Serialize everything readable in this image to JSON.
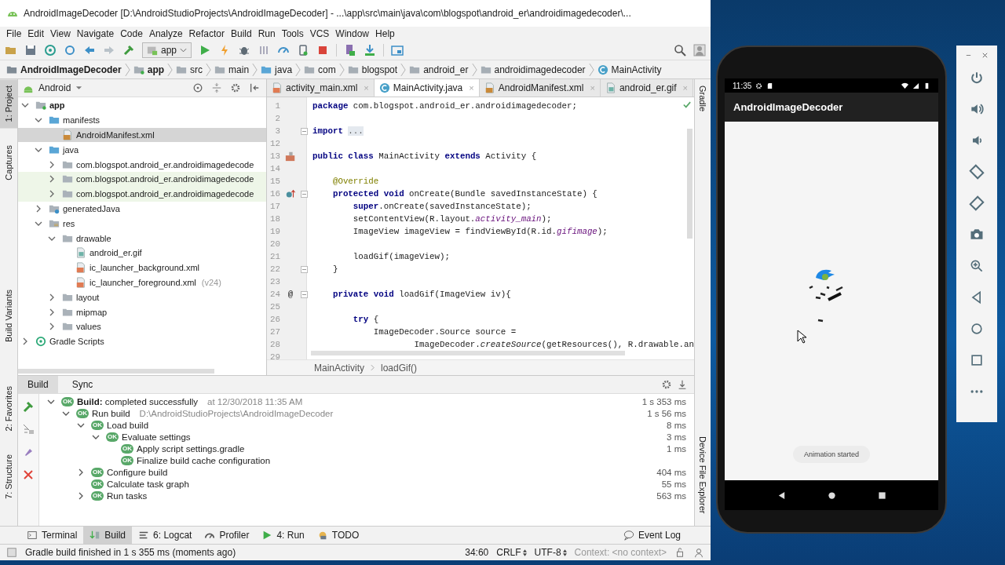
{
  "window": {
    "title": "AndroidImageDecoder [D:\\AndroidStudioProjects\\AndroidImageDecoder] - ...\\app\\src\\main\\java\\com\\blogspot\\android_er\\androidimagedecoder\\..."
  },
  "menu": [
    "File",
    "Edit",
    "View",
    "Navigate",
    "Code",
    "Analyze",
    "Refactor",
    "Build",
    "Run",
    "Tools",
    "VCS",
    "Window",
    "Help"
  ],
  "toolbar": {
    "run_config": "app"
  },
  "nav_bar": [
    {
      "label": "AndroidImageDecoder",
      "kind": "project"
    },
    {
      "label": "app",
      "kind": "module"
    },
    {
      "label": "src",
      "kind": "folder"
    },
    {
      "label": "main",
      "kind": "folder"
    },
    {
      "label": "java",
      "kind": "source"
    },
    {
      "label": "com",
      "kind": "folder"
    },
    {
      "label": "blogspot",
      "kind": "folder"
    },
    {
      "label": "android_er",
      "kind": "folder"
    },
    {
      "label": "androidimagedecoder",
      "kind": "folder"
    },
    {
      "label": "MainActivity",
      "kind": "class"
    }
  ],
  "left_strip_top": [
    {
      "label": "1: Project",
      "selected": true
    },
    {
      "label": "Captures",
      "selected": false
    }
  ],
  "left_strip_bottom": [
    {
      "label": "Build Variants",
      "selected": false
    },
    {
      "label": "2: Favorites",
      "selected": false
    },
    {
      "label": "7: Structure",
      "selected": false
    }
  ],
  "project": {
    "view": "Android",
    "tree": [
      {
        "label": "app",
        "kind": "module",
        "expanded": true,
        "selected": false,
        "test": false,
        "children": [
          {
            "label": "manifests",
            "kind": "source",
            "expanded": true,
            "selected": false,
            "test": false,
            "children": [
              {
                "label": "AndroidManifest.xml",
                "kind": "manifest",
                "selected": true,
                "test": false
              }
            ]
          },
          {
            "label": "java",
            "kind": "source",
            "expanded": true,
            "selected": false,
            "test": false,
            "children": [
              {
                "label": "com.blogspot.android_er.androidimagedecode",
                "kind": "package",
                "expanded": false,
                "selected": false,
                "test": false
              },
              {
                "label": "com.blogspot.android_er.androidimagedecode",
                "kind": "package",
                "expanded": false,
                "selected": false,
                "test": true
              },
              {
                "label": "com.blogspot.android_er.androidimagedecode",
                "kind": "package",
                "expanded": false,
                "selected": false,
                "test": true
              }
            ]
          },
          {
            "label": "generatedJava",
            "kind": "generated",
            "expanded": false,
            "selected": false,
            "test": false
          },
          {
            "label": "res",
            "kind": "res",
            "expanded": true,
            "selected": false,
            "test": false,
            "children": [
              {
                "label": "drawable",
                "kind": "package",
                "expanded": true,
                "selected": false,
                "test": false,
                "children": [
                  {
                    "label": "android_er.gif",
                    "kind": "gif",
                    "selected": false,
                    "test": false
                  },
                  {
                    "label": "ic_launcher_background.xml",
                    "kind": "xml",
                    "selected": false,
                    "test": false
                  },
                  {
                    "label": "ic_launcher_foreground.xml",
                    "hint": "(v24)",
                    "kind": "xml",
                    "selected": false,
                    "test": false
                  }
                ]
              },
              {
                "label": "layout",
                "kind": "package",
                "expanded": false,
                "selected": false,
                "test": false
              },
              {
                "label": "mipmap",
                "kind": "package",
                "expanded": false,
                "selected": false,
                "test": false
              },
              {
                "label": "values",
                "kind": "package",
                "expanded": false,
                "selected": false,
                "test": false
              }
            ]
          }
        ]
      },
      {
        "label": "Gradle Scripts",
        "kind": "gradle",
        "expanded": false,
        "selected": false,
        "test": false
      }
    ]
  },
  "editor": {
    "tabs": [
      {
        "label": "activity_main.xml",
        "kind": "xml",
        "close": "×",
        "selected": false
      },
      {
        "label": "MainActivity.java",
        "kind": "class",
        "close": "×",
        "selected": true
      },
      {
        "label": "AndroidManifest.xml",
        "kind": "manifest",
        "close": "×",
        "selected": false
      },
      {
        "label": "android_er.gif",
        "kind": "gif",
        "close": "×",
        "selected": false
      }
    ],
    "lines": [
      {
        "number": "1",
        "tokens": [
          {
            "text": "package",
            "kind": "keyword"
          },
          {
            "text": " com.blogspot.android_er.androidimagedecoder;",
            "kind": "plain"
          }
        ]
      },
      {
        "number": "2"
      },
      {
        "number": "3",
        "fold": true,
        "tokens": [
          {
            "text": "import ",
            "kind": "keyword"
          },
          {
            "text": "...",
            "kind": "folded"
          }
        ]
      },
      {
        "number": "12"
      },
      {
        "number": "13",
        "kind": "layout",
        "tokens": [
          {
            "text": "public class",
            "kind": "keyword"
          },
          {
            "text": " MainActivity ",
            "kind": "plain"
          },
          {
            "text": "extends",
            "kind": "keyword"
          },
          {
            "text": " Activity {",
            "kind": "plain"
          }
        ]
      },
      {
        "number": "14"
      },
      {
        "number": "15",
        "tokens": [
          {
            "text": "    @Override",
            "kind": "annotation"
          }
        ]
      },
      {
        "number": "16",
        "kind": "override",
        "fold": true,
        "tokens": [
          {
            "text": "    protected void",
            "kind": "keyword"
          },
          {
            "text": " onCreate(Bundle savedInstanceState) {",
            "kind": "plain"
          }
        ]
      },
      {
        "number": "17",
        "tokens": [
          {
            "text": "        super",
            "kind": "keyword"
          },
          {
            "text": ".onCreate(savedInstanceState);",
            "kind": "plain"
          }
        ]
      },
      {
        "number": "18",
        "tokens": [
          {
            "text": "        setContentView(R.layout.",
            "kind": "plain"
          },
          {
            "text": "activity_main",
            "kind": "field"
          },
          {
            "text": ");",
            "kind": "plain"
          }
        ]
      },
      {
        "number": "19",
        "tokens": [
          {
            "text": "        ImageView imageView = findViewById(R.id.",
            "kind": "plain"
          },
          {
            "text": "gifimage",
            "kind": "field"
          },
          {
            "text": ");",
            "kind": "plain"
          }
        ]
      },
      {
        "number": "20"
      },
      {
        "number": "21",
        "tokens": [
          {
            "text": "        loadGif(imageView);",
            "kind": "plain"
          }
        ]
      },
      {
        "number": "22",
        "fold": true,
        "tokens": [
          {
            "text": "    }",
            "kind": "plain"
          }
        ]
      },
      {
        "number": "23"
      },
      {
        "number": "24",
        "gutter_text": "@",
        "fold": true,
        "tokens": [
          {
            "text": "    private void",
            "kind": "keyword"
          },
          {
            "text": " loadGif(ImageView iv){",
            "kind": "plain"
          }
        ]
      },
      {
        "number": "25"
      },
      {
        "number": "26",
        "tokens": [
          {
            "text": "        try",
            "kind": "keyword"
          },
          {
            "text": " {",
            "kind": "plain"
          }
        ]
      },
      {
        "number": "27",
        "tokens": [
          {
            "text": "            ImageDecoder.Source source =",
            "kind": "plain"
          }
        ]
      },
      {
        "number": "28",
        "tokens": [
          {
            "text": "                    ImageDecoder.",
            "kind": "plain"
          },
          {
            "text": "createSource",
            "kind": "static"
          },
          {
            "text": "(getResources(), R.drawable.an",
            "kind": "plain"
          }
        ]
      },
      {
        "number": "29"
      }
    ],
    "breadcrumb": [
      "MainActivity",
      "loadGif()"
    ]
  },
  "right_strip_top": [
    {
      "label": "Gradle"
    }
  ],
  "right_strip_bottom": [
    {
      "label": "Device File Explorer"
    }
  ],
  "build": {
    "tabs": [
      {
        "label": "Build",
        "selected": true
      },
      {
        "label": "Sync",
        "selected": false
      }
    ],
    "tree": [
      {
        "label": "**Build:** completed successfully",
        "badge": "OK",
        "detail": "at 12/30/2018 11:35 AM",
        "time": "1 s 353 ms",
        "expanded": true,
        "children": [
          {
            "label": "Run build",
            "badge": "OK",
            "detail": "D:\\AndroidStudioProjects\\AndroidImageDecoder",
            "time": "1 s 56 ms",
            "expanded": true,
            "children": [
              {
                "label": "Load build",
                "badge": "OK",
                "time": "8 ms",
                "expanded": true,
                "children": [
                  {
                    "label": "Evaluate settings",
                    "badge": "OK",
                    "time": "3 ms",
                    "expanded": true,
                    "children": [
                      {
                        "label": "Apply script settings.gradle",
                        "badge": "OK",
                        "time": "1 ms"
                      },
                      {
                        "label": "Finalize build cache configuration",
                        "badge": "OK"
                      }
                    ]
                  }
                ]
              },
              {
                "label": "Configure build",
                "badge": "OK",
                "time": "404 ms",
                "expanded": false
              },
              {
                "label": "Calculate task graph",
                "badge": "OK",
                "time": "55 ms"
              },
              {
                "label": "Run tasks",
                "badge": "OK",
                "time": "563 ms",
                "expanded": false
              }
            ]
          }
        ]
      }
    ]
  },
  "tool_tabs": [
    {
      "label": "Terminal",
      "kind": "terminal",
      "selected": false
    },
    {
      "label": "Build",
      "kind": "build",
      "selected": true
    },
    {
      "label": "6: Logcat",
      "kind": "logcat",
      "selected": false
    },
    {
      "label": "Profiler",
      "kind": "profiler",
      "selected": false
    },
    {
      "label": "4: Run",
      "kind": "run",
      "selected": false
    },
    {
      "label": "TODO",
      "kind": "todo",
      "selected": false
    }
  ],
  "event_log": "Event Log",
  "status_bar": {
    "message": "Gradle build finished in 1 s 355 ms (moments ago)",
    "position": "34:60",
    "line_separator": "CRLF",
    "encoding": "UTF-8",
    "context": "Context: <no context>"
  },
  "phone": {
    "time": "11:35",
    "app_title": "AndroidImageDecoder",
    "toast": "Animation started"
  }
}
